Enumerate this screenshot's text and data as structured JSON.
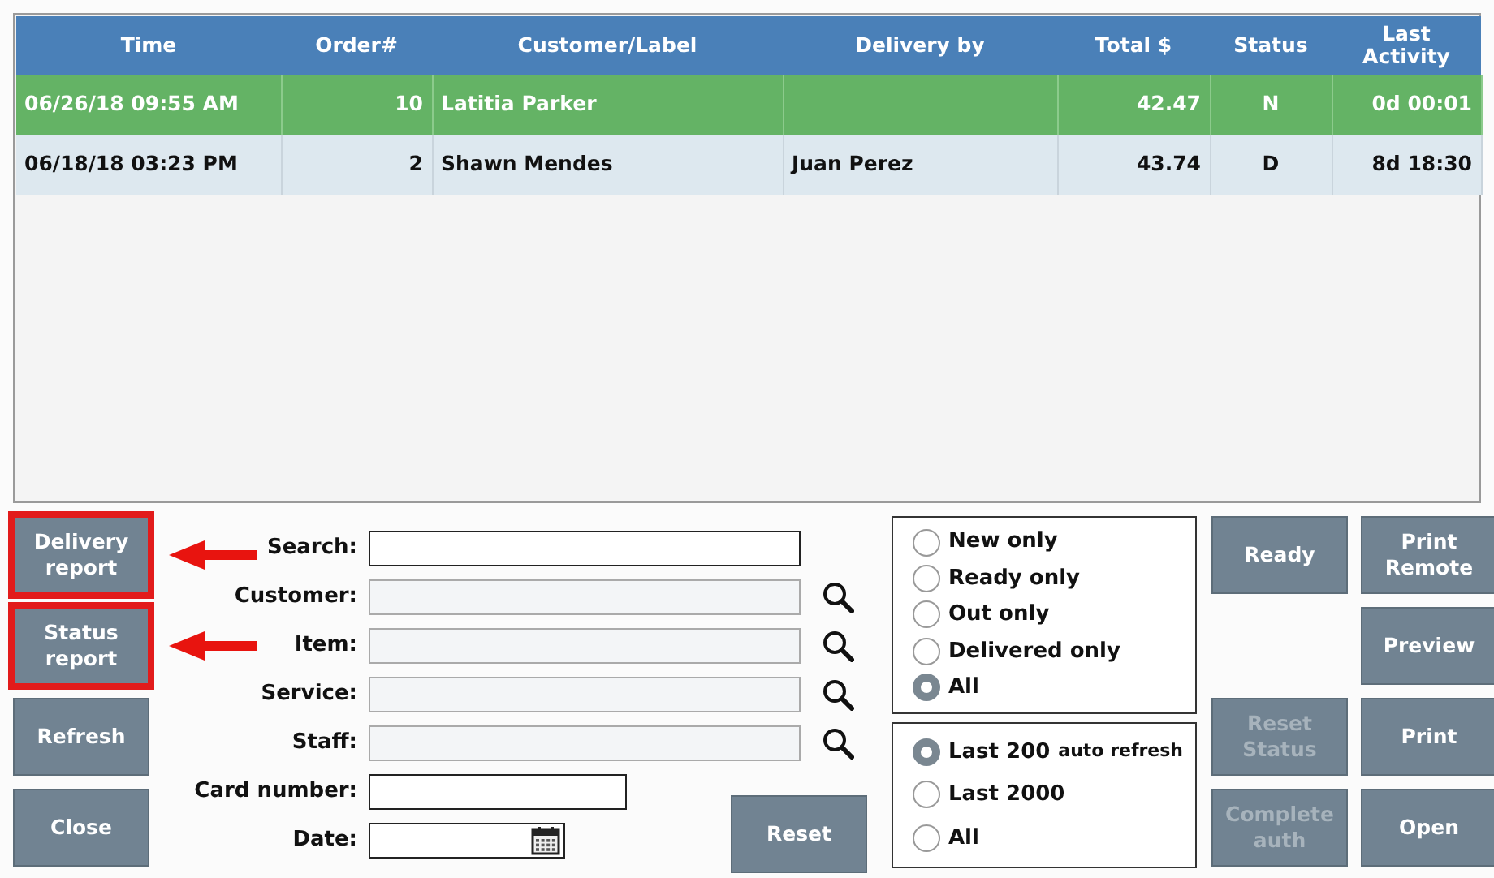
{
  "table": {
    "columns": [
      {
        "label": "Time"
      },
      {
        "label": "Order#"
      },
      {
        "label": "Customer/Label"
      },
      {
        "label": "Delivery by"
      },
      {
        "label": "Total $"
      },
      {
        "label": "Status"
      },
      {
        "label": "Last Activity"
      }
    ],
    "rows": [
      {
        "selected": true,
        "cells": [
          "06/26/18 09:55 AM",
          "10",
          "Latitia Parker",
          "",
          "42.47",
          "N",
          "0d 00:01"
        ]
      },
      {
        "selected": false,
        "cells": [
          "06/18/18 03:23 PM",
          "2",
          "Shawn Mendes",
          "Juan Perez",
          "43.74",
          "D",
          "8d 18:30"
        ]
      }
    ]
  },
  "side_buttons": [
    {
      "label": "Delivery report",
      "disabled": false,
      "highlighted": true
    },
    {
      "label": "Status report",
      "disabled": false,
      "highlighted": true
    },
    {
      "label": "Refresh",
      "disabled": false,
      "highlighted": false
    },
    {
      "label": "Close",
      "disabled": false,
      "highlighted": false
    }
  ],
  "fields": [
    {
      "label": "Search:",
      "kind": "text"
    },
    {
      "label": "Customer:",
      "kind": "lookup"
    },
    {
      "label": "Item:",
      "kind": "lookup"
    },
    {
      "label": "Service:",
      "kind": "lookup"
    },
    {
      "label": "Staff:",
      "kind": "lookup"
    },
    {
      "label": "Card number:",
      "kind": "short"
    },
    {
      "label": "Date:",
      "kind": "date"
    }
  ],
  "reset_button": {
    "label": "Reset",
    "disabled": false
  },
  "status_filter": [
    {
      "label": "New only",
      "selected": false
    },
    {
      "label": "Ready only",
      "selected": false
    },
    {
      "label": "Out only",
      "selected": false
    },
    {
      "label": "Delivered only",
      "selected": false
    },
    {
      "label": "All",
      "selected": true
    }
  ],
  "range_filter": [
    {
      "label": "Last 200",
      "note": "auto refresh",
      "selected": true
    },
    {
      "label": "Last 2000",
      "selected": false
    },
    {
      "label": "All",
      "selected": false
    }
  ],
  "status_buttons": [
    {
      "label": "Ready",
      "disabled": false
    },
    {
      "label": "Reset Status",
      "disabled": true
    },
    {
      "label": "Complete auth",
      "disabled": true
    }
  ],
  "output_buttons": [
    {
      "label": "Print Remote",
      "disabled": false
    },
    {
      "label": "Preview",
      "disabled": false
    },
    {
      "label": "Print",
      "disabled": false
    },
    {
      "label": "Open",
      "disabled": false
    }
  ]
}
